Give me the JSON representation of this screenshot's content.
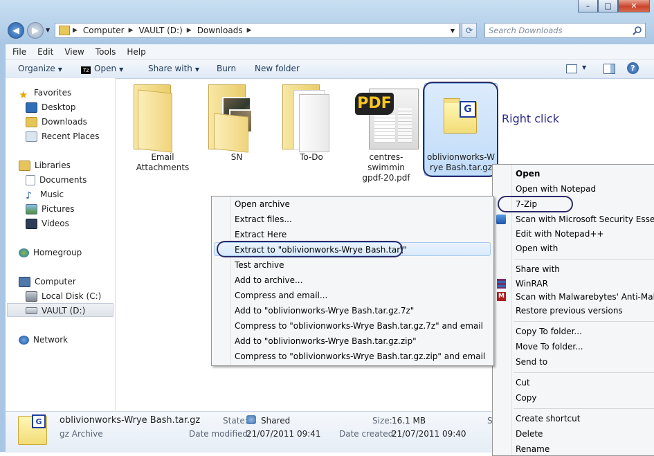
{
  "window": {
    "controls": [
      "–",
      "□",
      "✕"
    ],
    "breadcrumb": [
      "Computer",
      "VAULT (D:)",
      "Downloads"
    ],
    "search_placeholder": "Search Downloads"
  },
  "menubar": [
    "File",
    "Edit",
    "View",
    "Tools",
    "Help"
  ],
  "commandbar": {
    "organize": "Organize",
    "open": "Open",
    "share_with": "Share with",
    "burn": "Burn",
    "new_folder": "New folder"
  },
  "navpane": {
    "favorites": "Favorites",
    "favorites_items": [
      "Desktop",
      "Downloads",
      "Recent Places"
    ],
    "libraries": "Libraries",
    "libraries_items": [
      "Documents",
      "Music",
      "Pictures",
      "Videos"
    ],
    "homegroup": "Homegroup",
    "computer": "Computer",
    "computer_items": [
      "Local Disk (C:)",
      "VAULT (D:)"
    ],
    "network": "Network"
  },
  "files": [
    {
      "line1": "Email",
      "line2": "Attachments"
    },
    {
      "line1": "SN",
      "line2": ""
    },
    {
      "line1": "To-Do",
      "line2": ""
    },
    {
      "line1": "centres-swimmin",
      "line2": "gpdf-20.pdf"
    },
    {
      "line1": "oblivionworks-W",
      "line2": "rye Bash.tar.gz"
    }
  ],
  "pdf_badge": "PDF",
  "gz_badge": "G",
  "annotation": "Right click",
  "shell_menu": {
    "open": "Open",
    "open_with_notepad": "Open with Notepad",
    "seven_zip": "7-Zip",
    "scan_mse": "Scan with Microsoft Security Essentials...",
    "edit_notepadpp": "Edit with Notepad++",
    "open_with": "Open with",
    "share_with": "Share with",
    "winrar": "WinRAR",
    "scan_mbam": "Scan with Malwarebytes' Anti-Malware",
    "restore_versions": "Restore previous versions",
    "copy_to": "Copy To folder...",
    "move_to": "Move To folder...",
    "send_to": "Send to",
    "cut": "Cut",
    "copy": "Copy",
    "create_shortcut": "Create shortcut",
    "delete": "Delete",
    "rename": "Rename"
  },
  "zip_menu": [
    "Open archive",
    "Extract files...",
    "Extract Here",
    "Extract to \"oblivionworks-Wrye Bash.tar\\\"",
    "Test archive",
    "Add to archive...",
    "Compress and email...",
    "Add to \"oblivionworks-Wrye Bash.tar.gz.7z\"",
    "Compress to \"oblivionworks-Wrye Bash.tar.gz.7z\" and email",
    "Add to \"oblivionworks-Wrye Bash.tar.gz.zip\"",
    "Compress to \"oblivionworks-Wrye Bash.tar.gz.zip\" and email"
  ],
  "details": {
    "name": "oblivionworks-Wrye Bash.tar.gz",
    "type": "gz Archive",
    "state_label": "State:",
    "state_value": "Shared",
    "modified_label": "Date modified:",
    "modified_value": "21/07/2011 09:41",
    "size_label": "Size:",
    "size_value": "16.1 MB",
    "created_label": "Date created:",
    "created_value": "21/07/2011 09:40",
    "cut_letter": "S"
  }
}
